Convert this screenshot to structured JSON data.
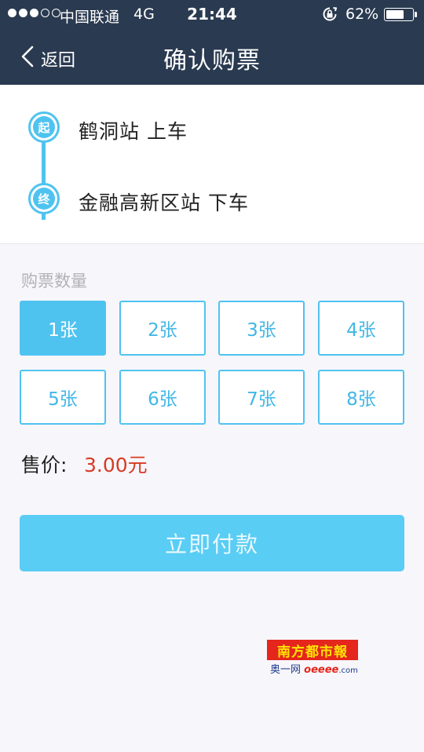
{
  "status_bar": {
    "carrier": "中国联通",
    "network": "4G",
    "time": "21:44",
    "battery_percent": "62%",
    "battery_level": 0.62,
    "signal_strength": 3,
    "signal_max": 5
  },
  "nav": {
    "back_label": "返回",
    "title": "确认购票"
  },
  "route": {
    "start_badge": "起",
    "start_text": "鹤洞站 上车",
    "end_badge": "终",
    "end_text": "金融高新区站 下车"
  },
  "quantity": {
    "label": "购票数量",
    "options": [
      "1张",
      "2张",
      "3张",
      "4张",
      "5张",
      "6张",
      "7张",
      "8张"
    ],
    "selected": "1张"
  },
  "price": {
    "label": "售价:",
    "value": "3.00元"
  },
  "pay_button": {
    "label": "立即付款"
  },
  "watermark": {
    "logo_text": "南方都市報",
    "sub_prefix": "奥一网",
    "sub_site": "oeeee",
    "sub_domain": ".com"
  },
  "colors": {
    "header_bg": "#2a3a50",
    "accent": "#4fc3f0",
    "price_red": "#d83a22",
    "page_bg": "#f7f6fb"
  },
  "icons": {
    "back": "chevron-left-icon",
    "orientation_lock": "rotation-lock-icon",
    "battery": "battery-icon"
  }
}
